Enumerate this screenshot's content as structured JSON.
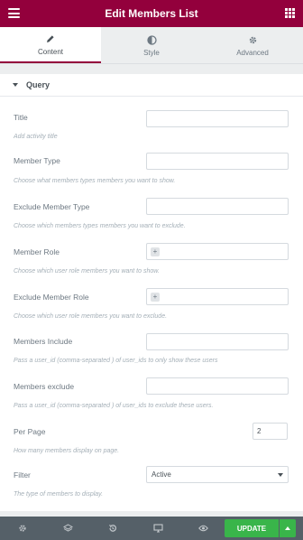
{
  "header": {
    "title": "Edit Members List"
  },
  "tabs": [
    {
      "label": "Content",
      "icon": "pencil-icon"
    },
    {
      "label": "Style",
      "icon": "contrast-icon"
    },
    {
      "label": "Advanced",
      "icon": "gear-icon"
    }
  ],
  "section": {
    "title": "Query"
  },
  "fields": {
    "title": {
      "label": "Title",
      "value": "",
      "description": "Add activity title"
    },
    "member_type": {
      "label": "Member Type",
      "value": "",
      "description": "Choose what members types members you want to show."
    },
    "exclude_member_type": {
      "label": "Exclude Member Type",
      "value": "",
      "description": "Choose which members types members you want to exclude."
    },
    "member_role": {
      "label": "Member Role",
      "add": "+",
      "description": "Choose which user role members you want to show."
    },
    "exclude_member_role": {
      "label": "Exclude Member Role",
      "add": "+",
      "description": "Choose which user role members you want to exclude."
    },
    "members_include": {
      "label": "Members Include",
      "value": "",
      "description": "Pass a user_id (comma-separated ) of user_ids to only show these users"
    },
    "members_exclude": {
      "label": "Members exclude",
      "value": "",
      "description": "Pass a user_id (comma-separated ) of user_ids to exclude these users."
    },
    "per_page": {
      "label": "Per Page",
      "value": "2",
      "description": "How many members display on page."
    },
    "filter": {
      "label": "Filter",
      "value": "Active",
      "description": "The type of members to display."
    }
  },
  "footer": {
    "update_label": "UPDATE"
  },
  "colors": {
    "brand": "#93003c",
    "update": "#39b54a",
    "footer": "#556068"
  }
}
